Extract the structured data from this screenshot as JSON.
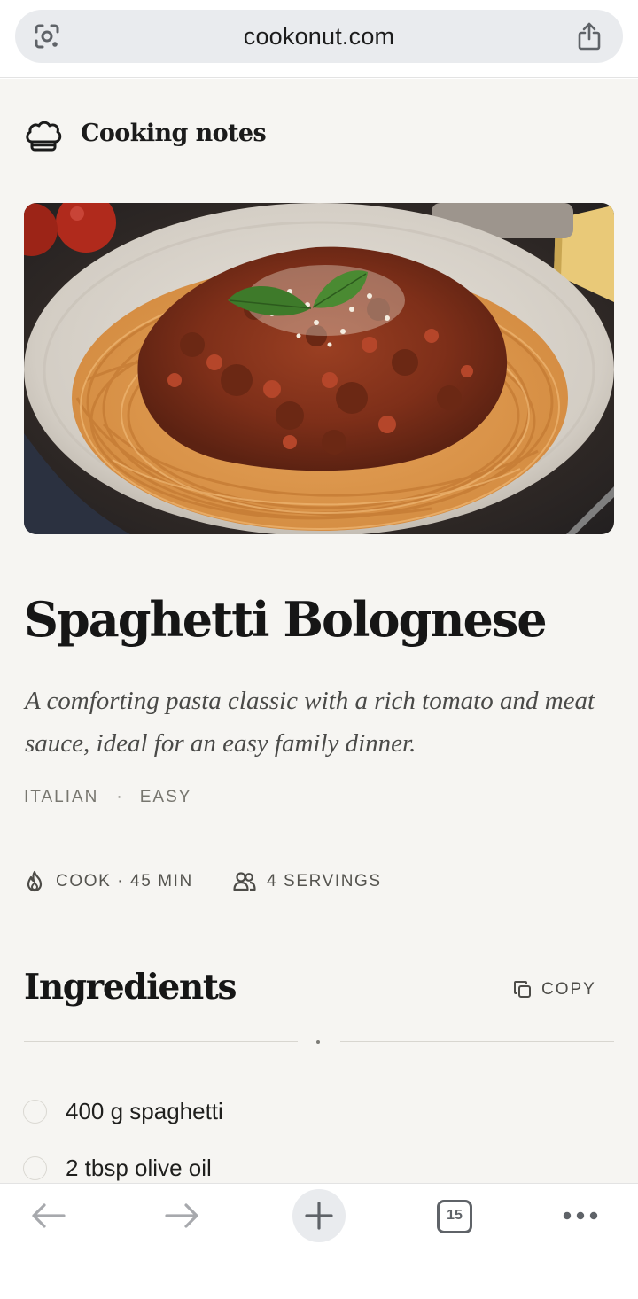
{
  "browser": {
    "url": "cookonut.com",
    "tab_count": "15"
  },
  "site": {
    "name": "Cooking notes"
  },
  "recipe": {
    "title": "Spaghetti Bolognese",
    "description": "A comforting pasta classic with a rich tomato and meat sauce, ideal for an easy family dinner.",
    "tags": [
      "ITALIAN",
      "EASY"
    ],
    "tag_separator": "·",
    "cook_time": "COOK · 45 MIN",
    "servings": "4 SERVINGS"
  },
  "ingredients": {
    "heading": "Ingredients",
    "copy_label": "COPY",
    "items": [
      {
        "label": "400 g spaghetti"
      },
      {
        "label": "2 tbsp olive oil"
      }
    ]
  },
  "icons": {
    "lens": "google-lens-icon",
    "share": "share-icon",
    "site_logo": "chef-hat-icon",
    "cook": "flame-icon",
    "servings": "people-icon",
    "copy": "copy-icon",
    "back": "arrow-left-icon",
    "forward": "arrow-right-icon",
    "new_tab": "plus-icon",
    "tabs": "tabs-icon",
    "menu": "more-horizontal-icon"
  },
  "colors": {
    "page_background": "#f6f5f2",
    "text_primary": "#161616",
    "text_muted": "#77766f",
    "chrome_pill": "#e9ebee"
  }
}
